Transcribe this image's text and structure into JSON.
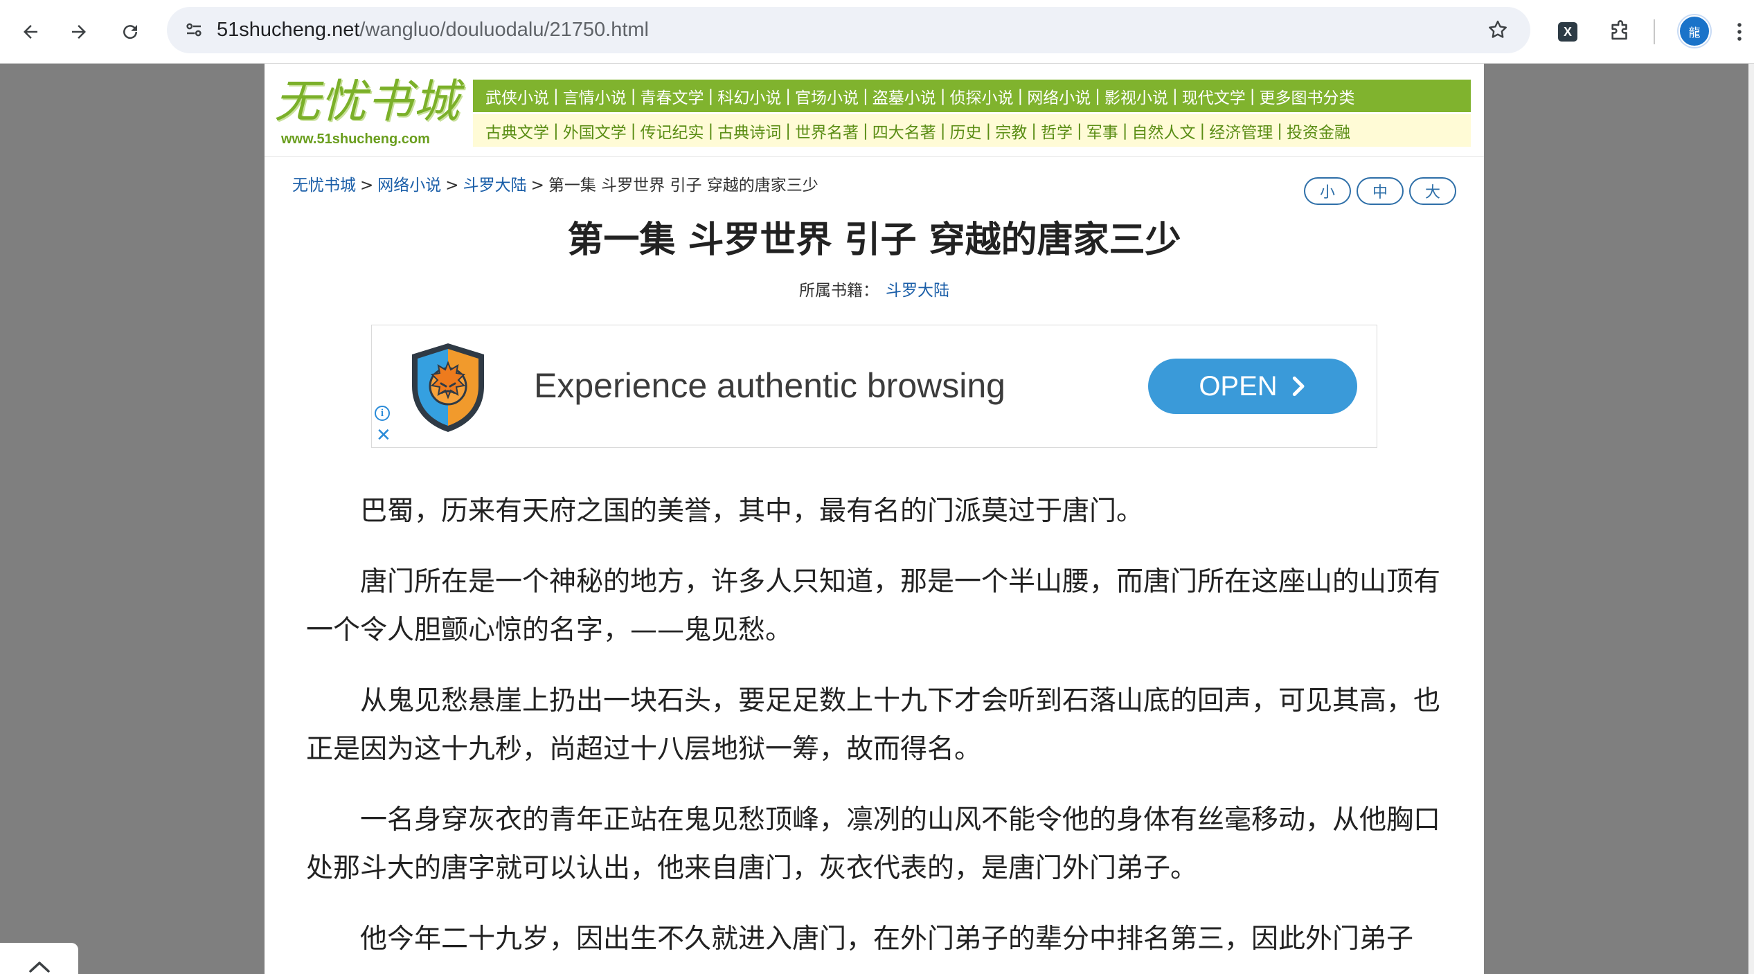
{
  "browser": {
    "url_host": "51shucheng.net",
    "url_path": "/wangluo/douluodalu/21750.html",
    "avatar_text": "龍",
    "extension_badge": "X"
  },
  "header": {
    "logo_title": "无忧书城",
    "logo_url": "www.51shucheng.com",
    "categories_row1": [
      "武侠小说",
      "言情小说",
      "青春文学",
      "科幻小说",
      "官场小说",
      "盗墓小说",
      "侦探小说",
      "网络小说",
      "影视小说",
      "现代文学",
      "更多图书分类"
    ],
    "categories_row2": [
      "古典文学",
      "外国文学",
      "传记纪实",
      "古典诗词",
      "世界名著",
      "四大名著",
      "历史",
      "宗教",
      "哲学",
      "军事",
      "自然人文",
      "经济管理",
      "投资金融"
    ],
    "separator": "|"
  },
  "breadcrumb": {
    "home": "无忧书城",
    "category": "网络小说",
    "book": "斗罗大陆",
    "current": "第一集 斗罗世界 引子 穿越的唐家三少",
    "separator": ">"
  },
  "font_size_buttons": [
    "小",
    "中",
    "大"
  ],
  "chapter": {
    "title": "第一集 斗罗世界 引子 穿越的唐家三少",
    "book_label": "所属书籍：",
    "book_name": "斗罗大陆"
  },
  "ad": {
    "text": "Experience authentic browsing",
    "button_label": "OPEN",
    "info_symbol": "i",
    "close_symbol": "✕"
  },
  "article": {
    "paragraphs": [
      "巴蜀，历来有天府之国的美誉，其中，最有名的门派莫过于唐门。",
      "唐门所在是一个神秘的地方，许多人只知道，那是一个半山腰，而唐门所在这座山的山顶有一个令人胆颤心惊的名字，——鬼见愁。",
      "从鬼见愁悬崖上扔出一块石头，要足足数上十九下才会听到石落山底的回声，可见其高，也正是因为这十九秒，尚超过十八层地狱一筹，故而得名。",
      "一名身穿灰衣的青年正站在鬼见愁顶峰，凛冽的山风不能令他的身体有丝毫移动，从他胸口处那斗大的唐字就可以认出，他来自唐门，灰衣代表的，是唐门外门弟子。",
      "他今年二十九岁，因出生不久就进入唐门，在外门弟子的辈分中排名第三，因此外门弟子"
    ]
  },
  "colors": {
    "nav_green": "#80b32e",
    "nav_yellow": "#fffbd6",
    "link_blue": "#1a5ea8",
    "ad_button": "#3a9ad9"
  }
}
